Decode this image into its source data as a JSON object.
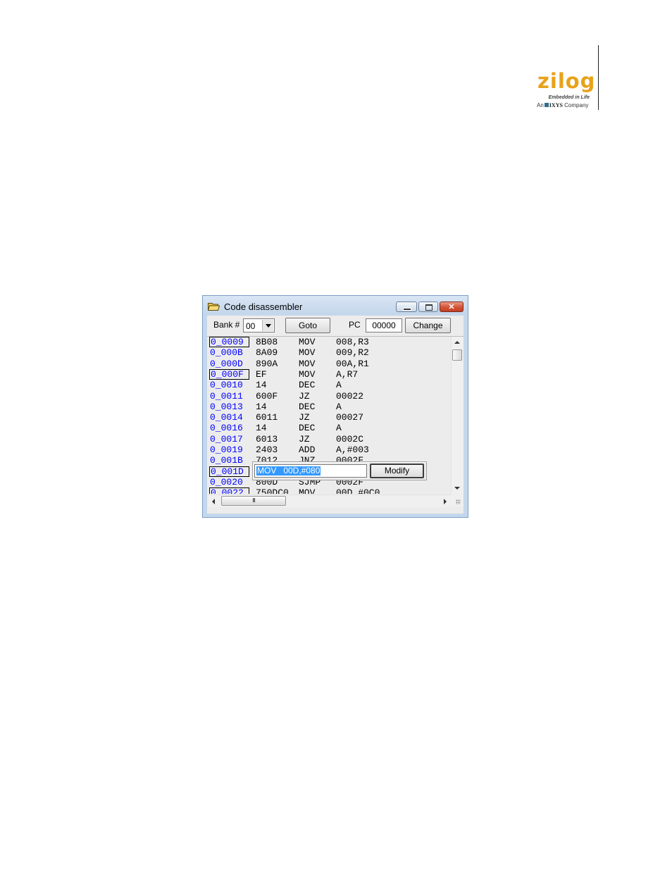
{
  "logo": {
    "brand_text": "zilog",
    "tagline": "Embedded in Life",
    "company_prefix": "An",
    "company_name": "IXYS",
    "company_suffix": "Company"
  },
  "window": {
    "title": "Code disassembler",
    "title_icon": "folder-open-icon",
    "controls": [
      "minimize-icon",
      "maximize-icon",
      "close-icon"
    ]
  },
  "toolbar": {
    "bank_label": "Bank #",
    "bank_value": "00",
    "goto_label": "Goto",
    "pc_label": "PC",
    "pc_value": "00000",
    "change_label": "Change"
  },
  "rows": [
    {
      "addr": "0_0009",
      "hex": "8B08",
      "mnemonic": "MOV",
      "operand": "008,R3",
      "boxed": true
    },
    {
      "addr": "0_000B",
      "hex": "8A09",
      "mnemonic": "MOV",
      "operand": "009,R2",
      "boxed": false
    },
    {
      "addr": "0_000D",
      "hex": "890A",
      "mnemonic": "MOV",
      "operand": "00A,R1",
      "boxed": false
    },
    {
      "addr": "0_000F",
      "hex": "EF",
      "mnemonic": "MOV",
      "operand": "A,R7",
      "boxed": true
    },
    {
      "addr": "0_0010",
      "hex": "14",
      "mnemonic": "DEC",
      "operand": "A",
      "boxed": false
    },
    {
      "addr": "0_0011",
      "hex": "600F",
      "mnemonic": "JZ",
      "operand": "00022",
      "boxed": false
    },
    {
      "addr": "0_0013",
      "hex": "14",
      "mnemonic": "DEC",
      "operand": "A",
      "boxed": false
    },
    {
      "addr": "0_0014",
      "hex": "6011",
      "mnemonic": "JZ",
      "operand": "00027",
      "boxed": false
    },
    {
      "addr": "0_0016",
      "hex": "14",
      "mnemonic": "DEC",
      "operand": "A",
      "boxed": false
    },
    {
      "addr": "0_0017",
      "hex": "6013",
      "mnemonic": "JZ",
      "operand": "0002C",
      "boxed": false
    },
    {
      "addr": "0_0019",
      "hex": "2403",
      "mnemonic": "ADD",
      "operand": "A,#003",
      "boxed": false
    },
    {
      "addr": "0_001B",
      "hex": "7012",
      "mnemonic": "JNZ",
      "operand": "0002F",
      "boxed": false
    },
    {
      "addr": "0_001D",
      "hex": "",
      "mnemonic": "",
      "operand": "",
      "boxed": true
    },
    {
      "addr": "0_0020",
      "hex": "800D",
      "mnemonic": "SJMP",
      "operand": "0002F",
      "boxed": false
    },
    {
      "addr": "0_0022",
      "hex": "750DC0",
      "mnemonic": "MOV",
      "operand": "00D,#0C0",
      "boxed": true
    }
  ],
  "edit": {
    "value": "MOV   00D,#080",
    "modify_label": "Modify"
  },
  "hscroll_grip": "III"
}
